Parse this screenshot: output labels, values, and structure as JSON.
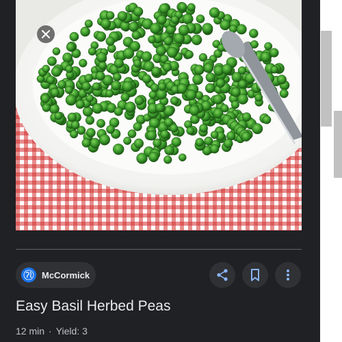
{
  "close": {
    "icon": "close-icon"
  },
  "hero": {
    "subject": "bowl of green peas with spoon on red gingham cloth"
  },
  "source": {
    "name": "McCormick",
    "icon": "globe-icon"
  },
  "actions": [
    {
      "name": "share",
      "icon": "share-icon"
    },
    {
      "name": "bookmark",
      "icon": "bookmark-icon"
    },
    {
      "name": "more",
      "icon": "more-vert-icon"
    }
  ],
  "recipe": {
    "title": "Easy Basil Herbed Peas",
    "time": "12 min",
    "separator": "·",
    "yield": "Yield: 3"
  },
  "colors": {
    "panel_bg": "#202124",
    "chip_bg": "#303134",
    "icon_blue": "#8ab4f8",
    "title_text": "#e8eaed",
    "pea_green": "#3a9a2a",
    "gingham_red": "#d32f2f"
  }
}
